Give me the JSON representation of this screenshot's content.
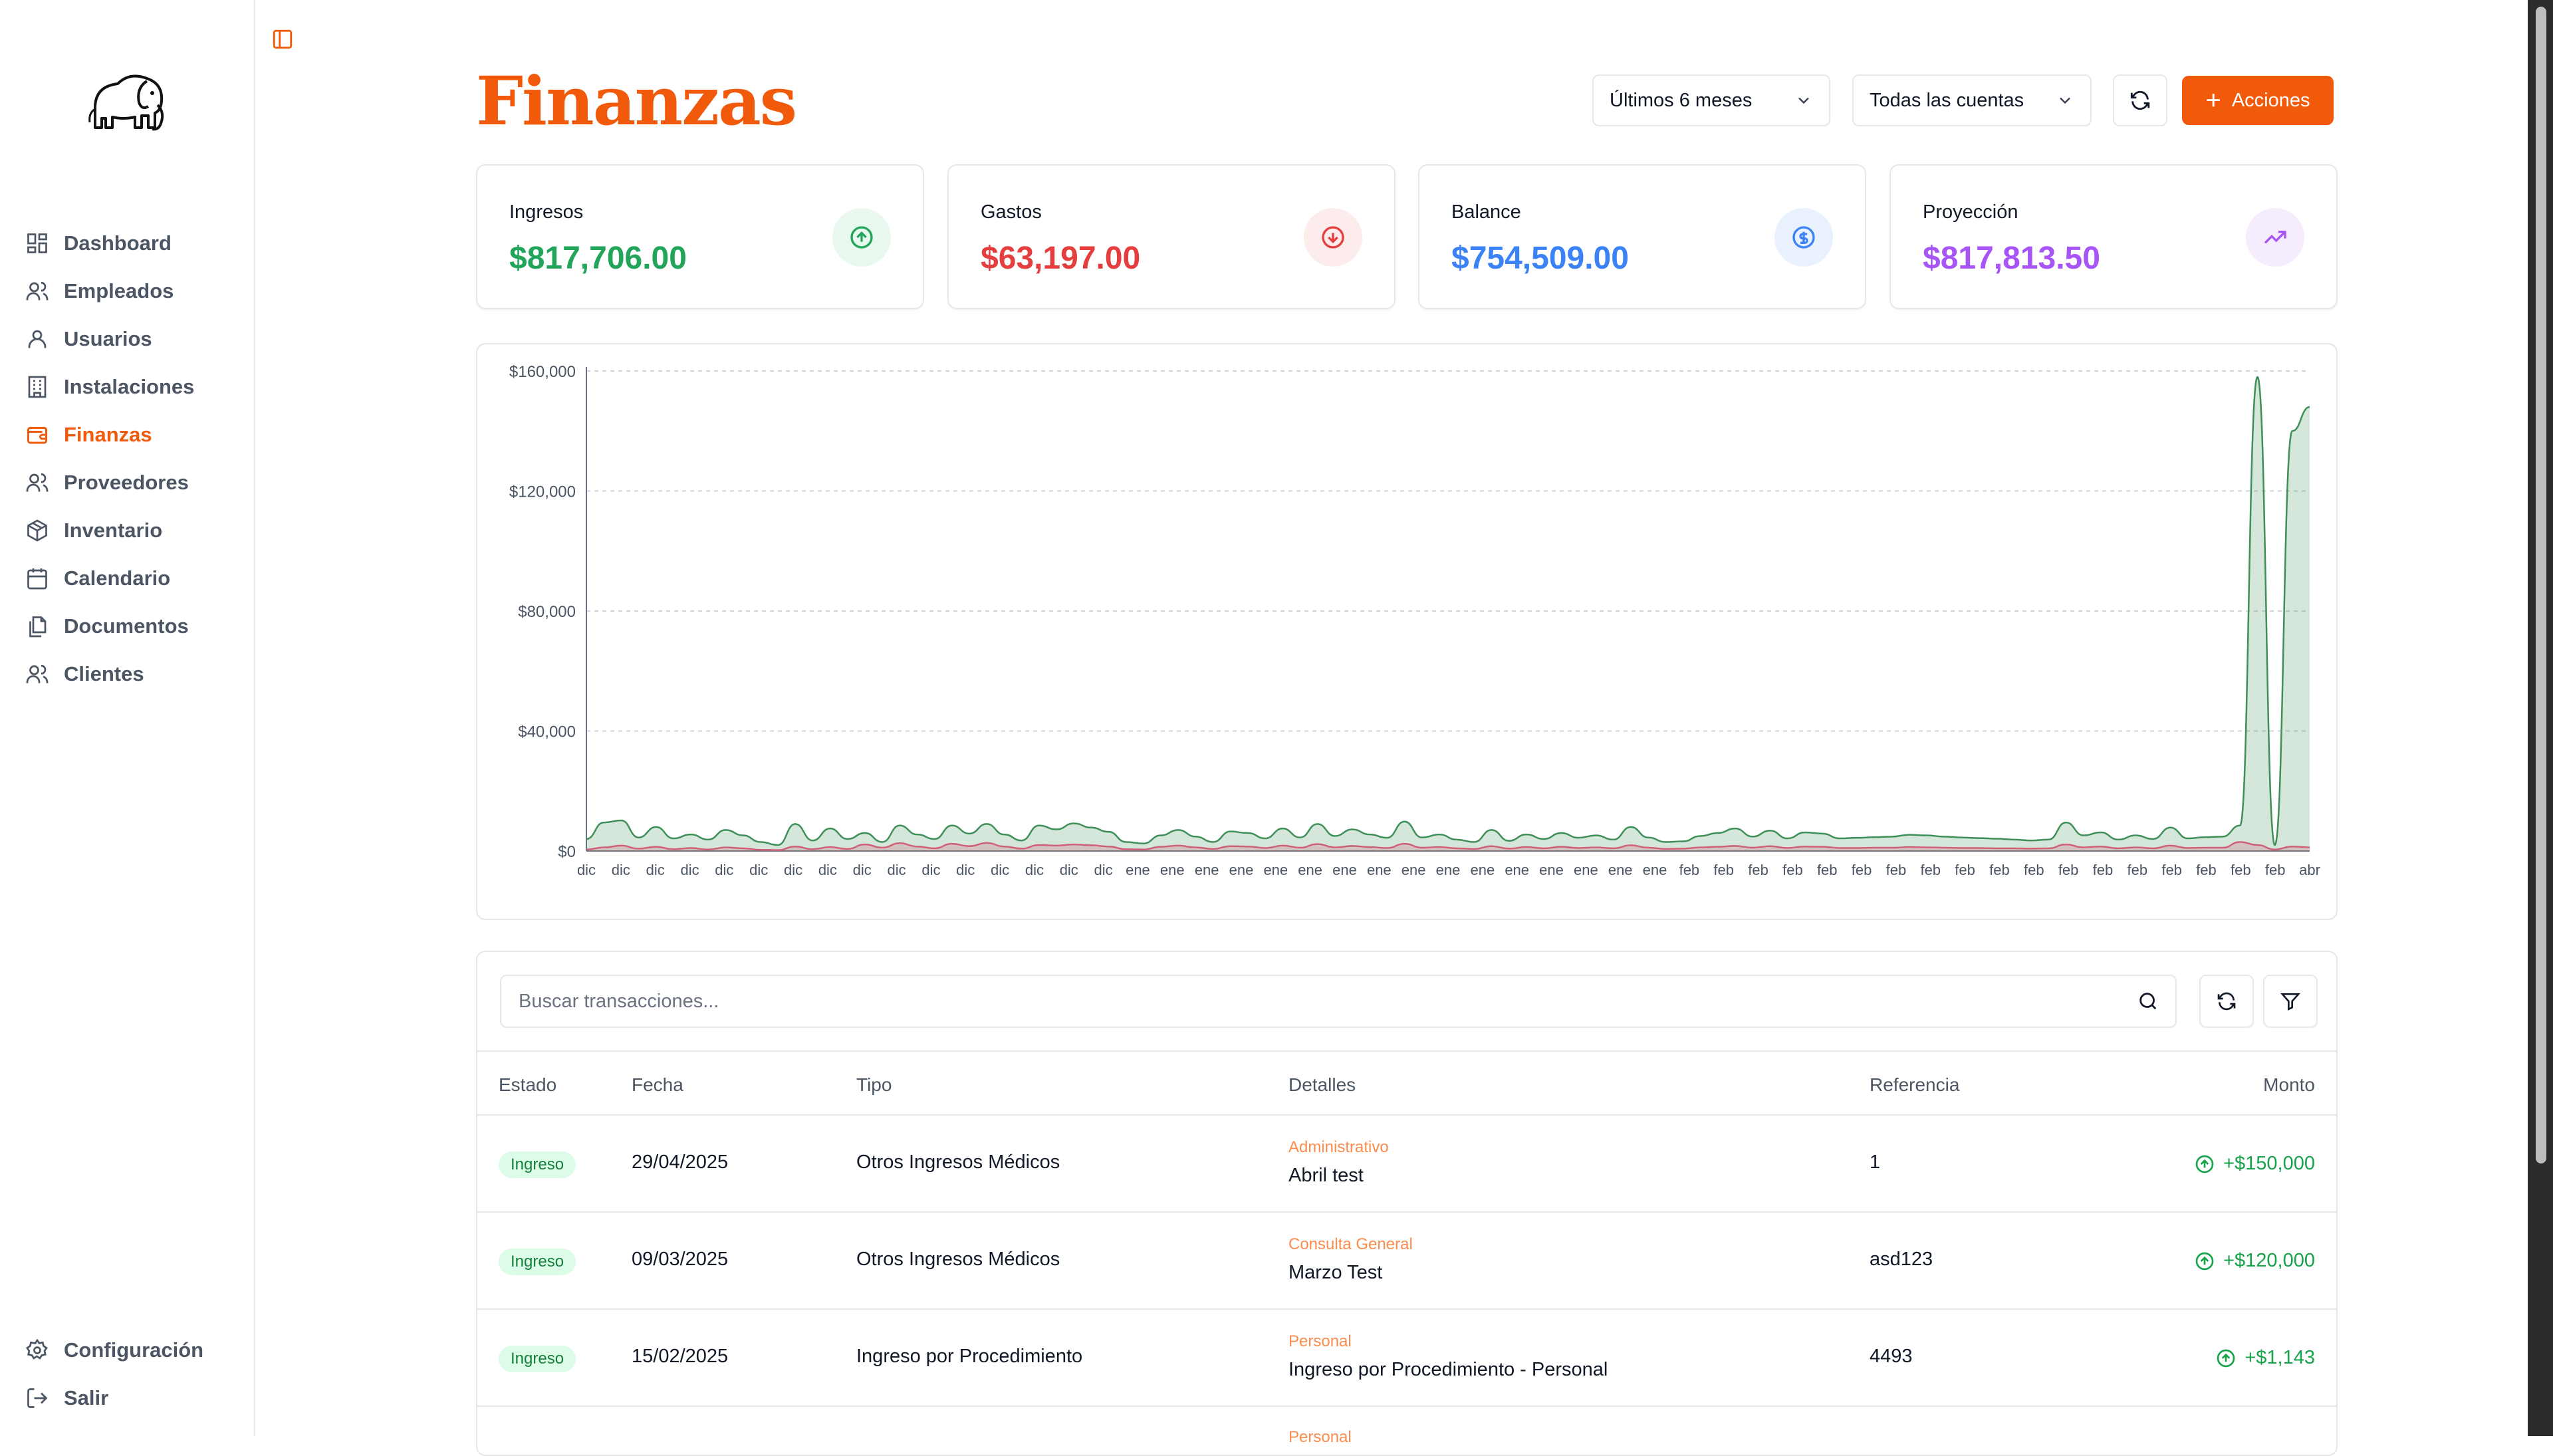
{
  "sidebar": {
    "nav": [
      {
        "label": "Dashboard",
        "icon": "dashboard-grid-icon",
        "active": false
      },
      {
        "label": "Empleados",
        "icon": "users-icon",
        "active": false
      },
      {
        "label": "Usuarios",
        "icon": "user-icon",
        "active": false
      },
      {
        "label": "Instalaciones",
        "icon": "building-icon",
        "active": false
      },
      {
        "label": "Finanzas",
        "icon": "wallet-icon",
        "active": true
      },
      {
        "label": "Proveedores",
        "icon": "users-icon",
        "active": false
      },
      {
        "label": "Inventario",
        "icon": "package-icon",
        "active": false
      },
      {
        "label": "Calendario",
        "icon": "calendar-icon",
        "active": false
      },
      {
        "label": "Documentos",
        "icon": "documents-icon",
        "active": false
      },
      {
        "label": "Clientes",
        "icon": "users-icon",
        "active": false
      }
    ],
    "bottom": [
      {
        "label": "Configuración",
        "icon": "gear-icon"
      },
      {
        "label": "Salir",
        "icon": "logout-icon"
      }
    ]
  },
  "header": {
    "title": "Finanzas",
    "period_select": "Últimos 6 meses",
    "account_select": "Todas las cuentas",
    "actions_label": "Acciones"
  },
  "stats": [
    {
      "label": "Ingresos",
      "value": "$817,706.00",
      "color": "#22a55a",
      "bg": "#e9f8ef",
      "icon": "arrow-up-circle-icon"
    },
    {
      "label": "Gastos",
      "value": "$63,197.00",
      "color": "#e53e3e",
      "bg": "#fdecec",
      "icon": "arrow-down-circle-icon"
    },
    {
      "label": "Balance",
      "value": "$754,509.00",
      "color": "#3b82f6",
      "bg": "#eaf1fe",
      "icon": "dollar-circle-icon"
    },
    {
      "label": "Proyección",
      "value": "$817,813.50",
      "color": "#a855f7",
      "bg": "#f5edfe",
      "icon": "trending-up-icon"
    }
  ],
  "chart_data": {
    "type": "area",
    "ylim": [
      0,
      160000
    ],
    "ytick_labels": [
      "$0",
      "$40,000",
      "$80,000",
      "$120,000",
      "$160,000"
    ],
    "grid": true,
    "colors": {
      "income": "#3f8f58",
      "expense": "#d0607a"
    },
    "x": [
      "dic",
      "dic",
      "dic",
      "dic",
      "dic",
      "dic",
      "dic",
      "dic",
      "dic",
      "dic",
      "dic",
      "dic",
      "dic",
      "dic",
      "dic",
      "dic",
      "ene",
      "ene",
      "ene",
      "ene",
      "ene",
      "ene",
      "ene",
      "ene",
      "ene",
      "ene",
      "ene",
      "ene",
      "ene",
      "ene",
      "ene",
      "ene",
      "feb",
      "feb",
      "feb",
      "feb",
      "feb",
      "feb",
      "feb",
      "feb",
      "feb",
      "feb",
      "feb",
      "feb",
      "feb",
      "feb",
      "feb",
      "feb",
      "feb",
      "feb",
      "abr"
    ],
    "series": [
      {
        "values": [
          4000,
          9500,
          10200,
          4500,
          8000,
          4200,
          5500,
          3800,
          7000,
          5200,
          3000,
          2000,
          9000,
          3500,
          7500,
          4000,
          6000,
          3000,
          8500,
          5500,
          4000,
          8500,
          5800,
          9000,
          5500,
          3500,
          8500,
          7200,
          9200,
          7800,
          6400,
          3000,
          2500,
          5200,
          7000,
          4800,
          3000,
          6500,
          6000,
          4200,
          7500,
          4500,
          9000,
          5000,
          7200,
          5500,
          4400,
          9800,
          4500,
          5500,
          3800,
          3000,
          7000,
          3400,
          5500,
          4000,
          6000,
          4400,
          5200,
          3800,
          8000,
          4500,
          3000,
          3200,
          5000,
          6000,
          7500,
          4800,
          6800,
          4200,
          6200,
          5800,
          4200,
          4400,
          4600,
          4800,
          5400,
          5200,
          4800,
          4500,
          4300,
          4100,
          3800,
          3500,
          3800,
          9500,
          5200,
          6200,
          3800,
          5200,
          4000,
          7800,
          4200,
          4600,
          4800,
          8500,
          158000,
          2000,
          140000,
          148000
        ]
      },
      {
        "values": [
          500,
          1200,
          1800,
          800,
          1400,
          600,
          1000,
          500,
          1200,
          900,
          400,
          300,
          1500,
          600,
          1300,
          700,
          2200,
          1100,
          2600,
          1500,
          900,
          2400,
          1600,
          2700,
          1500,
          800,
          2000,
          1800,
          2200,
          1900,
          1500,
          600,
          500,
          1400,
          1800,
          1200,
          700,
          1600,
          1500,
          1000,
          1800,
          1100,
          2300,
          1200,
          1700,
          1300,
          1000,
          2400,
          1100,
          1300,
          900,
          700,
          1600,
          800,
          1300,
          900,
          1400,
          1000,
          1200,
          900,
          1900,
          1100,
          700,
          800,
          1200,
          1400,
          1700,
          1100,
          1600,
          1000,
          1500,
          1400,
          1000,
          1000,
          1100,
          1100,
          1300,
          1200,
          1100,
          1000,
          1000,
          900,
          900,
          800,
          900,
          2200,
          1200,
          1500,
          900,
          1200,
          900,
          1800,
          1000,
          1100,
          1100,
          3000,
          2000,
          500,
          1500,
          1200
        ]
      }
    ]
  },
  "table": {
    "search_placeholder": "Buscar transacciones...",
    "headers": {
      "estado": "Estado",
      "fecha": "Fecha",
      "tipo": "Tipo",
      "detalles": "Detalles",
      "referencia": "Referencia",
      "monto": "Monto"
    },
    "rows": [
      {
        "estado": "Ingreso",
        "fecha": "29/04/2025",
        "tipo": "Otros Ingresos Médicos",
        "categoria": "Administrativo",
        "detalle": "Abril test",
        "referencia": "1",
        "monto": "+$150,000"
      },
      {
        "estado": "Ingreso",
        "fecha": "09/03/2025",
        "tipo": "Otros Ingresos Médicos",
        "categoria": "Consulta General",
        "detalle": "Marzo Test",
        "referencia": "asd123",
        "monto": "+$120,000"
      },
      {
        "estado": "Ingreso",
        "fecha": "15/02/2025",
        "tipo": "Ingreso por Procedimiento",
        "categoria": "Personal",
        "detalle": "Ingreso por Procedimiento - Personal",
        "referencia": "4493",
        "monto": "+$1,143"
      },
      {
        "estado": "",
        "fecha": "",
        "tipo": "",
        "categoria": "Personal",
        "detalle": "",
        "referencia": "",
        "monto": ""
      }
    ]
  }
}
